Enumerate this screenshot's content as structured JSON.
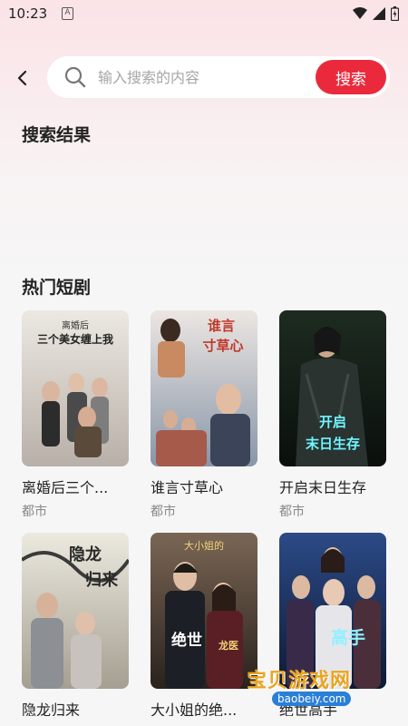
{
  "status_bar": {
    "time": "10:23",
    "notif_letter": "A"
  },
  "search": {
    "placeholder": "输入搜索的内容",
    "value": "",
    "button_label": "搜索"
  },
  "results": {
    "title": "搜索结果"
  },
  "hot": {
    "title": "热门短剧",
    "items": [
      {
        "title": "离婚后三个...",
        "tag": "都市",
        "poster_text": "离婚后 三个美女缠上我",
        "colors": [
          "#e8e4df",
          "#b9b2ab"
        ]
      },
      {
        "title": "谁言寸草心",
        "tag": "都市",
        "poster_text": "谁言寸草心",
        "colors": [
          "#d9d0c9",
          "#7b8aa0"
        ]
      },
      {
        "title": "开启末日生存",
        "tag": "都市",
        "poster_text": "开启末日生存",
        "colors": [
          "#1b2a1e",
          "#0c100d"
        ]
      },
      {
        "title": "隐龙归来",
        "tag": "",
        "poster_text": "隐龙归来",
        "colors": [
          "#e9e5da",
          "#a9a293"
        ]
      },
      {
        "title": "大小姐的绝...",
        "tag": "",
        "poster_text": "大小姐的 绝世龙医",
        "colors": [
          "#6b5a4a",
          "#2e2520"
        ]
      },
      {
        "title": "绝世高手",
        "tag": "",
        "poster_text": "绝世高手",
        "colors": [
          "#243a6a",
          "#0f1c3a"
        ]
      }
    ]
  },
  "watermark": {
    "text": "宝贝游戏网",
    "url": "baobeiy.com"
  }
}
